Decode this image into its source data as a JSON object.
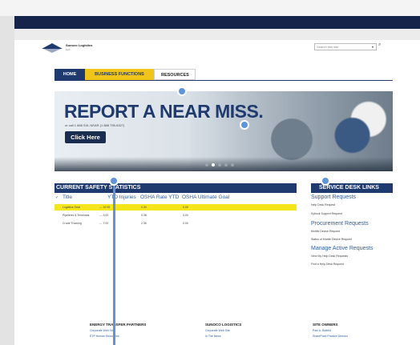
{
  "logo": {
    "name": "Sunoco Logistics",
    "sub": "LLC"
  },
  "search": {
    "placeholder": "Search this site",
    "caret": "▾",
    "button": "⌕"
  },
  "nav": {
    "tabs": [
      "HOME",
      "BUSINESS FUNCTIONS",
      "RESOURCES"
    ]
  },
  "banner": {
    "headline": "REPORT A NEAR MISS.",
    "call_line": "or call 1 888 SXL NEAR (1 888 795-6327)",
    "button": "Click Here"
  },
  "safety": {
    "title": "CURRENT SAFETY STATISTICS",
    "check": "✓",
    "columns": [
      "Title",
      "YTD Injuries",
      "OSHA Rate YTD",
      "OSHA Ultimate Goal"
    ],
    "rows": [
      {
        "title": "Logistics Total",
        "ytd": "--- 10.00",
        "rate": "0.30",
        "goal": "0.00",
        "highlight": true
      },
      {
        "title": "Pipelines & Terminals",
        "ytd": "--- 3.00",
        "rate": "0.38",
        "goal": "0.00",
        "highlight": false
      },
      {
        "title": "Crude Trucking",
        "ytd": "--- 7.00",
        "rate": "2.36",
        "goal": "0.00",
        "highlight": false
      }
    ]
  },
  "links": {
    "title": "SERVICE DESK LINKS",
    "groups": [
      {
        "heading": "Support Requests",
        "items": [
          "Help Desk Request",
          "Sybock Support Request"
        ]
      },
      {
        "heading": "Procurement Requests",
        "items": [
          "Mobile Device Request",
          "Status of Mobile Device Request"
        ]
      },
      {
        "heading": "Manage Active Requests",
        "items": [
          "View My Help Desk Requests",
          "Find a Help Desk Request"
        ]
      }
    ]
  },
  "footer": {
    "columns": [
      {
        "heading": "ENERGY TRANSFER PARTNERS",
        "items": [
          "Corporate Web Site",
          "ETP Human Resources"
        ]
      },
      {
        "heading": "SUNOCO LOGISTICS",
        "items": [
          "Corporate Web Site",
          "In The News"
        ]
      },
      {
        "heading": "SITE OWNERS",
        "items": [
          "Paul A. Botfeld",
          "SharePoint Practice Director"
        ]
      }
    ]
  },
  "colors": {
    "navy": "#1f3a6e",
    "yellow": "#f0c419",
    "highlight": "#f5e51b",
    "link": "#2e5c9a",
    "marker": "#5f95d8"
  }
}
